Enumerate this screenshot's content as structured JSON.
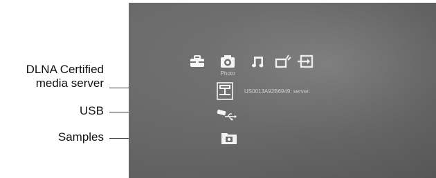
{
  "callouts": {
    "dlna_line1": "DLNA Certified",
    "dlna_line2": "media server",
    "usb": "USB",
    "samples": "Samples"
  },
  "categories": [
    {
      "icon": "toolbox-icon",
      "label": ""
    },
    {
      "icon": "camera-icon",
      "label": "Photo"
    },
    {
      "icon": "music-note-icon",
      "label": ""
    },
    {
      "icon": "video-icon",
      "label": ""
    },
    {
      "icon": "input-icon",
      "label": ""
    }
  ],
  "server": {
    "name": "US0013A92B6949: server:"
  },
  "colors": {
    "screen_bg": "#6f6f6f",
    "icon": "#ffffff",
    "text": "#d9d9d9"
  }
}
